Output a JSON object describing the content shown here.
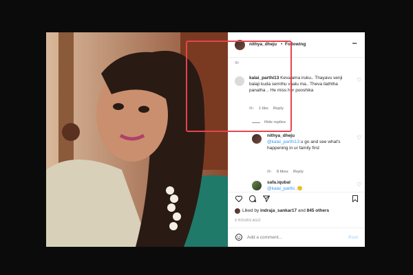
{
  "post": {
    "username": "nithya_dheju",
    "separator": "•",
    "follow_status": "Following",
    "more_label": "•••",
    "caption_time": "9h"
  },
  "comments": [
    {
      "username": "kalai_parthi13",
      "text": "Kevalama iruku.. Thayavu senji balaji kuda sernthu vaalu ma.. Theva ilaththa panatha .. He miss her pooshika",
      "time": "8h",
      "likes": "1 like",
      "reply": "Reply",
      "hide_replies": "Hide replies",
      "replies": [
        {
          "username": "nithya_dheju",
          "mention": "@kalai_parthi13",
          "text": " u go and see what's happening in ur family first",
          "time": "8h",
          "likes": "8 likes",
          "reply": "Reply"
        }
      ]
    },
    {
      "username": "safa.iqubal",
      "text": "@kalai_parthi..🙂"
    }
  ],
  "likes_line": {
    "prefix": "Liked by ",
    "user": "indraja_sankar17",
    "middle": " and ",
    "others": "845 others"
  },
  "timestamp": "9 HOURS AGO",
  "comment_box": {
    "placeholder": "Add a comment...",
    "post_label": "Post"
  },
  "icons": [
    "heart-icon",
    "comment-icon",
    "share-icon",
    "bookmark-icon",
    "emoji-icon"
  ],
  "colors": {
    "highlight": "#e8434e",
    "link": "#3897f0",
    "post_disabled": "#b3dbff"
  }
}
